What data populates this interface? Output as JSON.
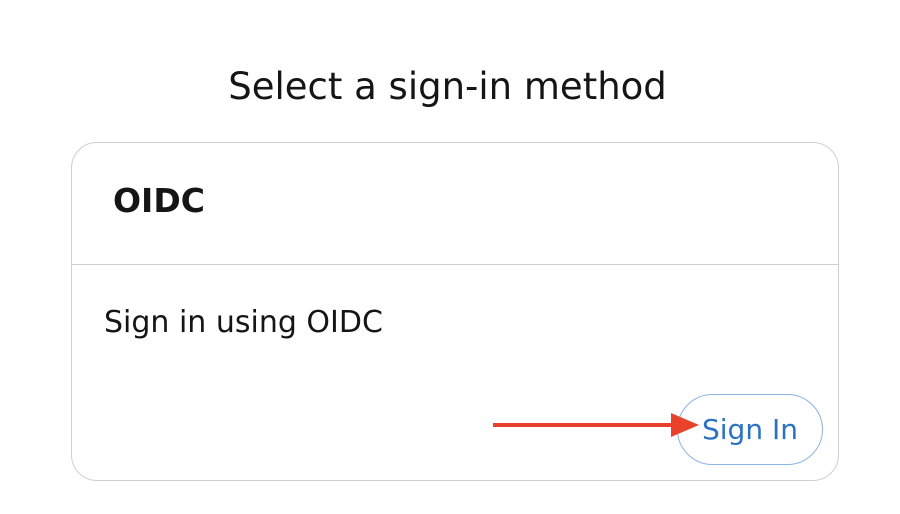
{
  "page": {
    "heading": "Select a sign-in method"
  },
  "card": {
    "title": "OIDC",
    "description": "Sign in using OIDC",
    "button_label": "Sign In"
  },
  "annotation": {
    "arrow_color": "#e8412c"
  },
  "colors": {
    "text": "#151515",
    "link_blue": "#2b73c2",
    "button_border": "#8ab4e2",
    "card_border": "#cfcfcf"
  }
}
